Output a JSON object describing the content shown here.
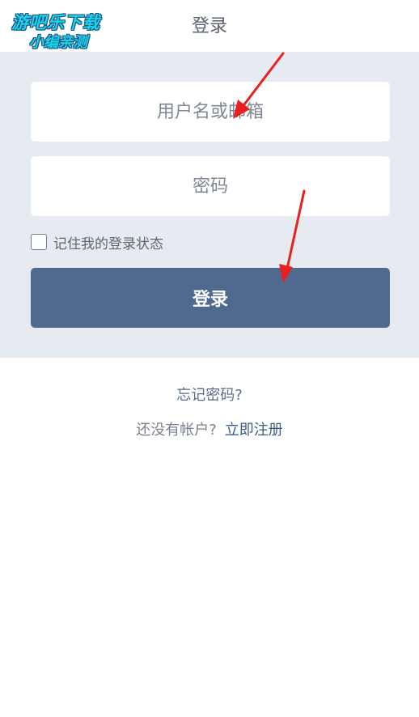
{
  "header": {
    "title": "登录"
  },
  "watermark": {
    "line1": "游吧乐下载",
    "line2": "小编亲测"
  },
  "form": {
    "username_placeholder": "用户名或邮箱",
    "password_placeholder": "密码",
    "username_value": "",
    "password_value": "",
    "remember_label": "记住我的登录状态",
    "remember_checked": false,
    "login_button": "登录"
  },
  "links": {
    "forgot_password": "忘记密码?",
    "no_account": "还没有帐户?",
    "register": "立即注册"
  },
  "colors": {
    "panel_bg": "#e6eaf1",
    "button_bg": "#4f6a8e",
    "annotation_arrow": "#e8201e"
  }
}
